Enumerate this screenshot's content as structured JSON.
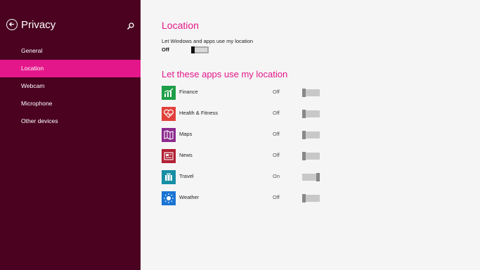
{
  "sidebar": {
    "title": "Privacy",
    "items": [
      {
        "label": "General"
      },
      {
        "label": "Location"
      },
      {
        "label": "Webcam"
      },
      {
        "label": "Microphone"
      },
      {
        "label": "Other devices"
      }
    ],
    "active_index": 1,
    "back_icon": "back-arrow-icon",
    "search_icon": "search-icon"
  },
  "location": {
    "heading": "Location",
    "description": "Let Windows and apps use my location",
    "state": "Off"
  },
  "apps": {
    "heading": "Let these apps use my location",
    "list": [
      {
        "name": "Finance",
        "state": "Off",
        "color": "#1f9e47",
        "icon": "finance-icon"
      },
      {
        "name": "Health & Fitness",
        "state": "Off",
        "color": "#e2413b",
        "icon": "health-icon"
      },
      {
        "name": "Maps",
        "state": "Off",
        "color": "#8c2a8e",
        "icon": "maps-icon"
      },
      {
        "name": "News",
        "state": "Off",
        "color": "#b32034",
        "icon": "news-icon"
      },
      {
        "name": "Travel",
        "state": "On",
        "color": "#168ea4",
        "icon": "travel-icon"
      },
      {
        "name": "Weather",
        "state": "Off",
        "color": "#1a74d4",
        "icon": "weather-icon"
      }
    ]
  },
  "colors": {
    "sidebar_bg": "#4a0220",
    "accent": "#e4178a",
    "page_bg": "#f5f5f5"
  }
}
